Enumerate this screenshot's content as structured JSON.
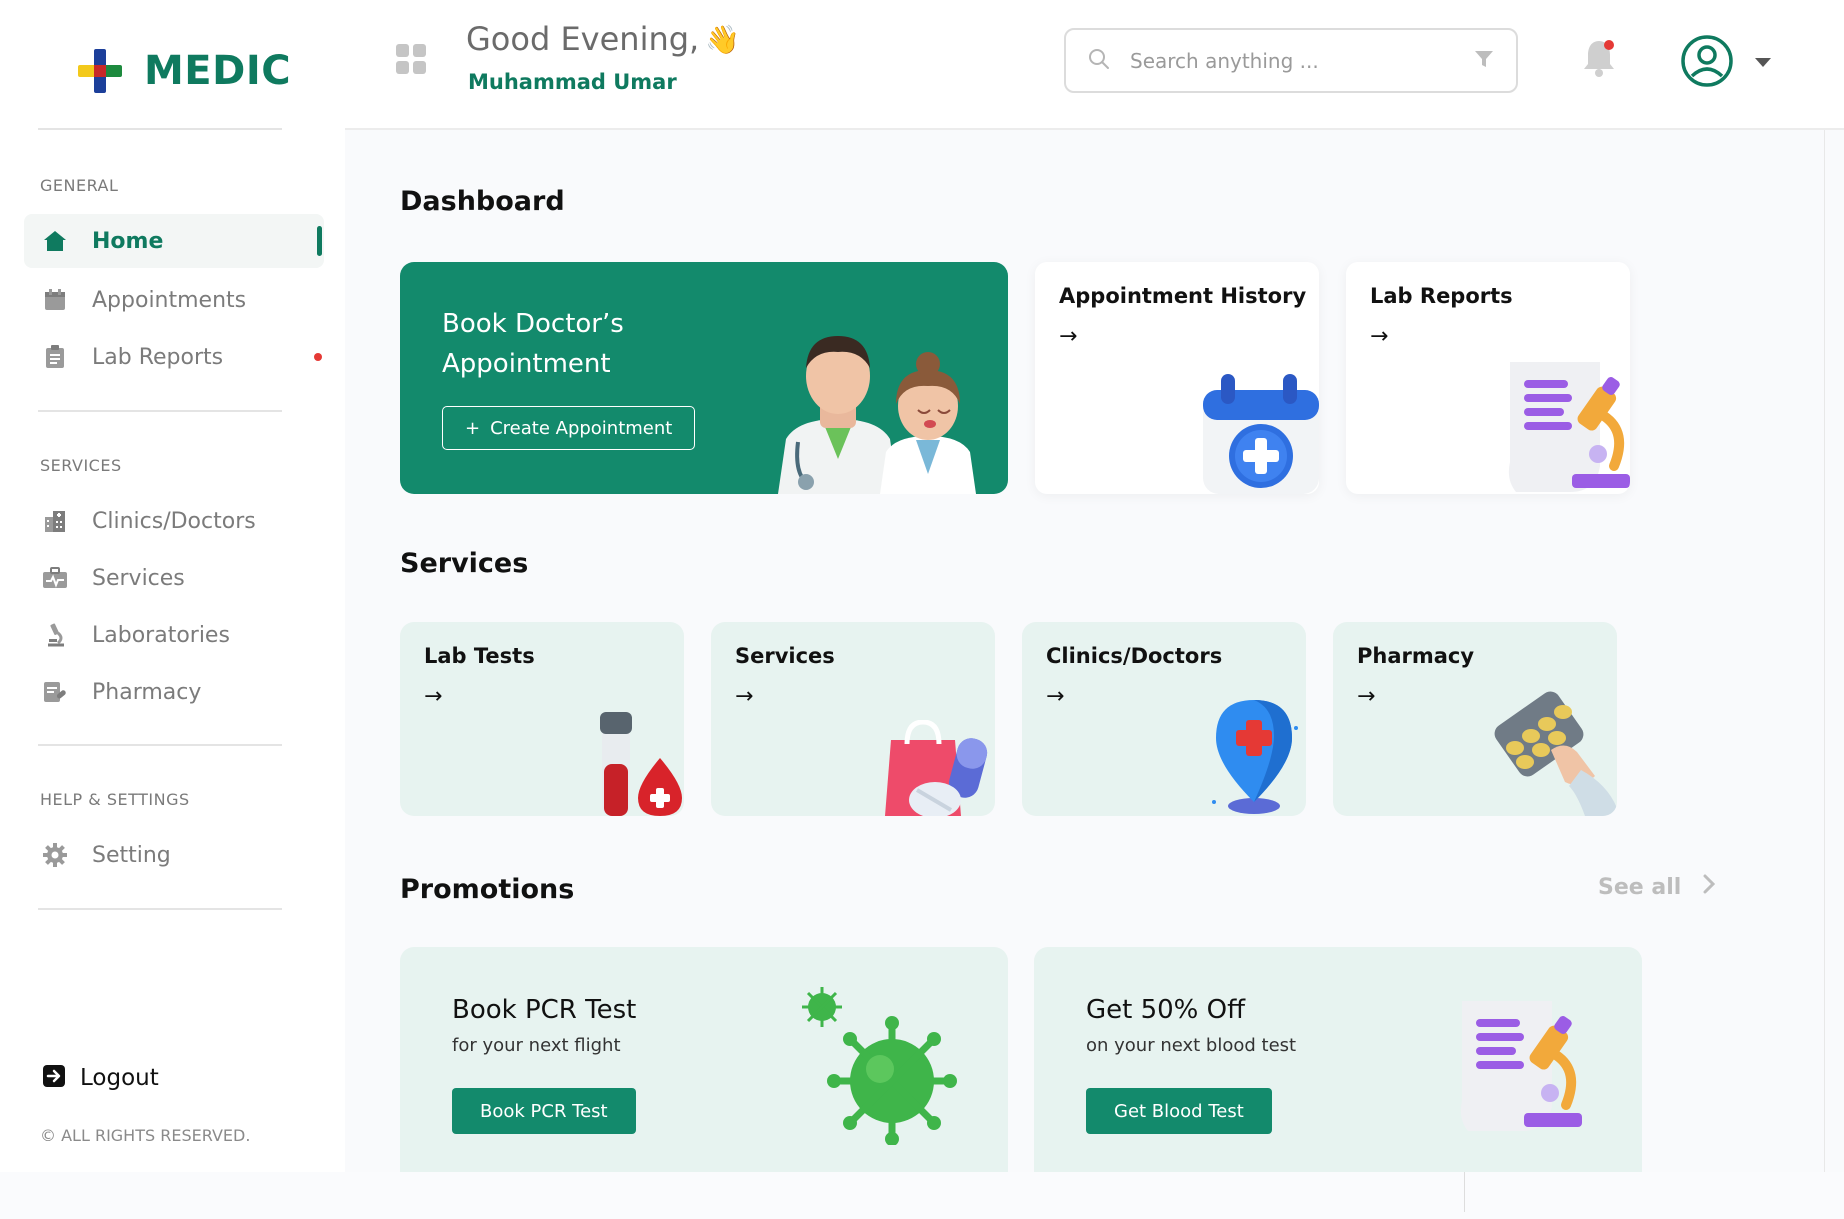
{
  "brand": {
    "name": "MEDIC"
  },
  "sidebar": {
    "sections": [
      {
        "label": "GENERAL"
      },
      {
        "label": "SERVICES"
      },
      {
        "label": "HELP & SETTINGS"
      }
    ],
    "items": [
      {
        "label": "Home"
      },
      {
        "label": "Appointments"
      },
      {
        "label": "Lab Reports"
      },
      {
        "label": "Clinics/Doctors"
      },
      {
        "label": "Services"
      },
      {
        "label": "Laboratories"
      },
      {
        "label": "Pharmacy"
      },
      {
        "label": "Setting"
      }
    ],
    "logout": "Logout",
    "copyright": "© ALL RIGHTS RESERVED."
  },
  "header": {
    "greeting": "Good Evening,",
    "greeting_emoji": "👋",
    "user": "Muhammad Umar",
    "search_placeholder": "Search anything ..."
  },
  "dashboard": {
    "title": "Dashboard",
    "book_card": {
      "title": "Book Doctor’s Appointment",
      "button_label": "Create Appointment",
      "button_prefix": "+"
    },
    "cards": [
      {
        "title": "Appointment History",
        "arrow": "→"
      },
      {
        "title": "Lab Reports",
        "arrow": "→"
      }
    ]
  },
  "services": {
    "title": "Services",
    "cards": [
      {
        "title": "Lab Tests",
        "arrow": "→"
      },
      {
        "title": "Services",
        "arrow": "→"
      },
      {
        "title": "Clinics/Doctors",
        "arrow": "→"
      },
      {
        "title": "Pharmacy",
        "arrow": "→"
      }
    ]
  },
  "promotions": {
    "title": "Promotions",
    "see_all": "See all",
    "cards": [
      {
        "title": "Book PCR Test",
        "subtitle": "for your next flight",
        "button": "Book PCR Test"
      },
      {
        "title": "Get 50% Off",
        "subtitle": "on your next blood test",
        "button": "Get Blood Test"
      }
    ]
  },
  "colors": {
    "primary": "#138a6c",
    "brand_text": "#0f7a5f",
    "card_bg": "#e7f3f0",
    "alert": "#e53935"
  }
}
